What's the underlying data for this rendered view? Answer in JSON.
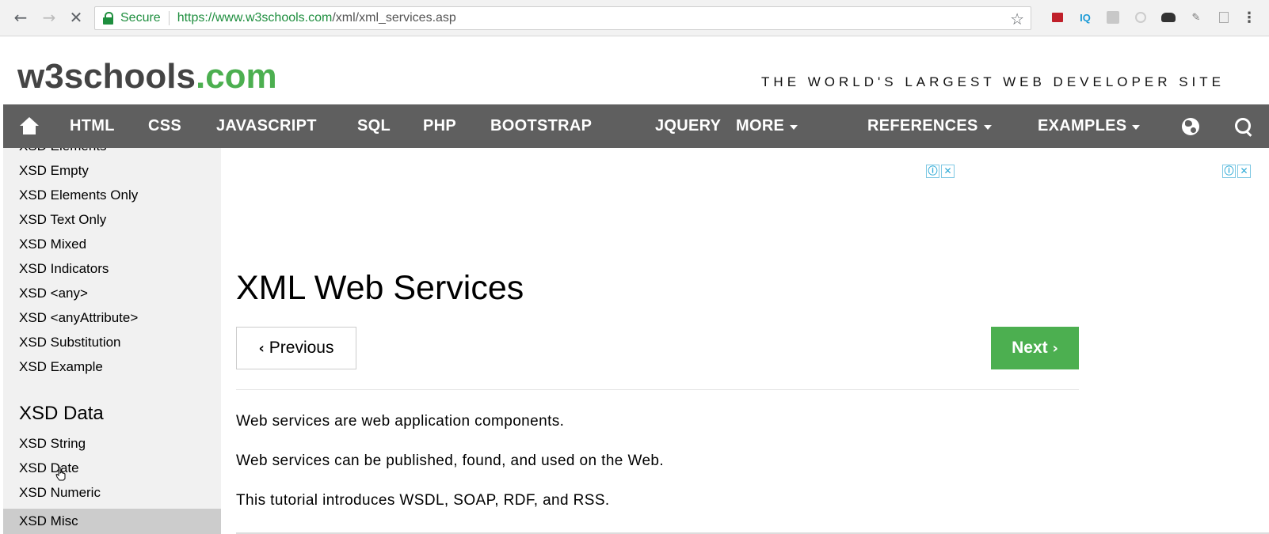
{
  "browser": {
    "back_icon": "arrow-left-icon",
    "forward_icon": "arrow-right-icon",
    "stop_icon": "close-icon",
    "secure_label": "Secure",
    "url_prefix": "https://",
    "url_host": "www.w3schools.com",
    "url_path": "/xml/xml_services.asp",
    "bookmark_icon": "star-icon",
    "menu_icon": "kebab-menu-icon",
    "extension_iq": "IQ"
  },
  "header": {
    "logo_main": "w3schools",
    "logo_tld": ".com",
    "tagline": "THE WORLD'S LARGEST WEB DEVELOPER SITE"
  },
  "topnav": {
    "items": [
      "HTML",
      "CSS",
      "JAVASCRIPT",
      "SQL",
      "PHP",
      "BOOTSTRAP",
      "JQUERY"
    ],
    "more": "MORE",
    "references": "REFERENCES",
    "examples": "EXAMPLES"
  },
  "sidebar": {
    "partial_top": "XSD Elements",
    "links": [
      "XSD Empty",
      "XSD Elements Only",
      "XSD Text Only",
      "XSD Mixed",
      "XSD Indicators",
      "XSD <any>",
      "XSD <anyAttribute>",
      "XSD Substitution",
      "XSD Example"
    ],
    "section_heading": "XSD Data",
    "data_links": [
      "XSD String",
      "XSD Date",
      "XSD Numeric",
      "XSD Misc"
    ]
  },
  "main": {
    "title": "XML Web Services",
    "prev_label": "Previous",
    "next_label": "Next",
    "paragraphs": [
      "Web services are web application components.",
      "Web services can be published, found, and used on the Web.",
      "This tutorial introduces WSDL, SOAP, RDF, and RSS."
    ],
    "ad_info_icon": "ⓘ",
    "ad_close_icon": "✕"
  },
  "colors": {
    "brand_green": "#4caf50",
    "nav_bg": "#5f5f5f",
    "sidebar_bg": "#f1f1f1",
    "secure_green": "#1e8e3e"
  }
}
